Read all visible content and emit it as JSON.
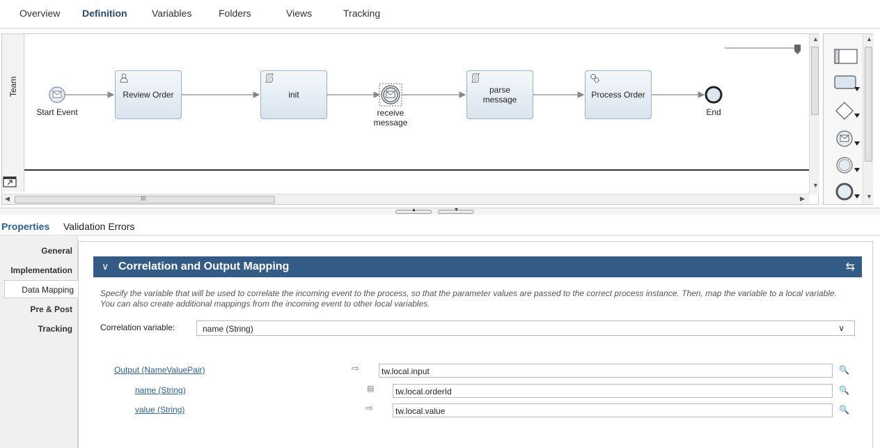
{
  "top_tabs": [
    "Overview",
    "Definition",
    "Variables",
    "Folders",
    "Views",
    "Tracking"
  ],
  "active_top_tab": "Definition",
  "lane": {
    "name": "Team"
  },
  "nodes": {
    "start": "Start Event",
    "review": "Review Order",
    "init": "init",
    "receive_line1": "receive",
    "receive_line2": "message",
    "parse_line1": "parse",
    "parse_line2": "message",
    "process": "Process Order",
    "end": "End"
  },
  "hscroll_marker": "III",
  "properties_tabs": [
    "Properties",
    "Validation Errors"
  ],
  "nav": [
    "General",
    "Implementation",
    "Data Mapping",
    "Pre & Post",
    "Tracking"
  ],
  "active_nav": "Data Mapping",
  "section": {
    "title": "Correlation and Output Mapping",
    "description_line1": "Specify the variable that will be used to correlate the incoming event to the process, so that the parameter values are passed to the correct process instance. Then, map the variable to a local variable.",
    "description_line2": "You can also create additional mappings from the incoming event to other local variables.",
    "correlation_label": "Correlation variable:",
    "correlation_value": "name (String)"
  },
  "mappings": [
    {
      "label": "Output (NameValuePair)",
      "value": "tw.local.input"
    },
    {
      "label": "name (String)",
      "value": "tw.local.orderId"
    },
    {
      "label": "value (String)",
      "value": "tw.local.value"
    }
  ],
  "colors": {
    "header_bg": "#345b86",
    "link": "#2c5f8e",
    "task_border": "#9bb0c4"
  }
}
